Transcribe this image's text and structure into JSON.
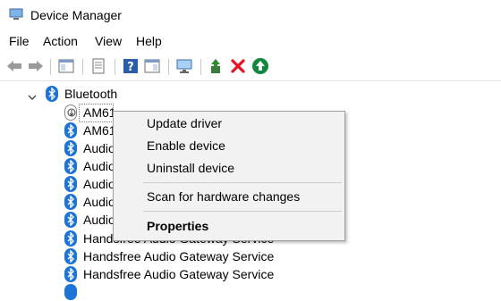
{
  "window": {
    "title": "Device Manager"
  },
  "menu": {
    "items": [
      "File",
      "Action",
      "View",
      "Help"
    ]
  },
  "toolbar": {
    "buttons": [
      "back-icon",
      "forward-icon",
      "show-hide-console-tree-icon",
      "properties-icon",
      "help-icon",
      "action-pane-icon",
      "scan-hardware-icon",
      "update-driver-icon",
      "uninstall-icon",
      "enable-device-icon"
    ],
    "colors": {
      "remove": "#e81123",
      "enable": "#10893e",
      "bluetooth": "#1e73d6"
    }
  },
  "tree": {
    "category": "Bluetooth",
    "devices": [
      "AM61",
      "AM61",
      "Audio",
      "Audio",
      "Audio",
      "Audio",
      "Audio",
      "Handsfree Audio Gateway Service",
      "Handsfree Audio Gateway Service",
      "Handsfree Audio Gateway Service"
    ]
  },
  "context_menu": {
    "update_driver": "Update driver",
    "enable_device": "Enable device",
    "uninstall_device": "Uninstall device",
    "scan": "Scan for hardware changes",
    "properties": "Properties"
  }
}
